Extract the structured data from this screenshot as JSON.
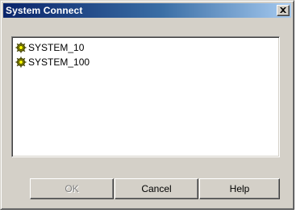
{
  "window": {
    "title": "System Connect"
  },
  "systems": [
    {
      "label": "SYSTEM_10",
      "icon": "system-node-icon"
    },
    {
      "label": "SYSTEM_100",
      "icon": "system-node-icon"
    }
  ],
  "buttons": {
    "ok_label": "OK",
    "ok_enabled": false,
    "cancel_label": "Cancel",
    "help_label": "Help"
  },
  "colors": {
    "titlebar_start": "#0a246a",
    "titlebar_end": "#a6caf0",
    "dialog_face": "#d4d0c8",
    "icon_olive": "#808000",
    "icon_yellow": "#ffff00"
  }
}
